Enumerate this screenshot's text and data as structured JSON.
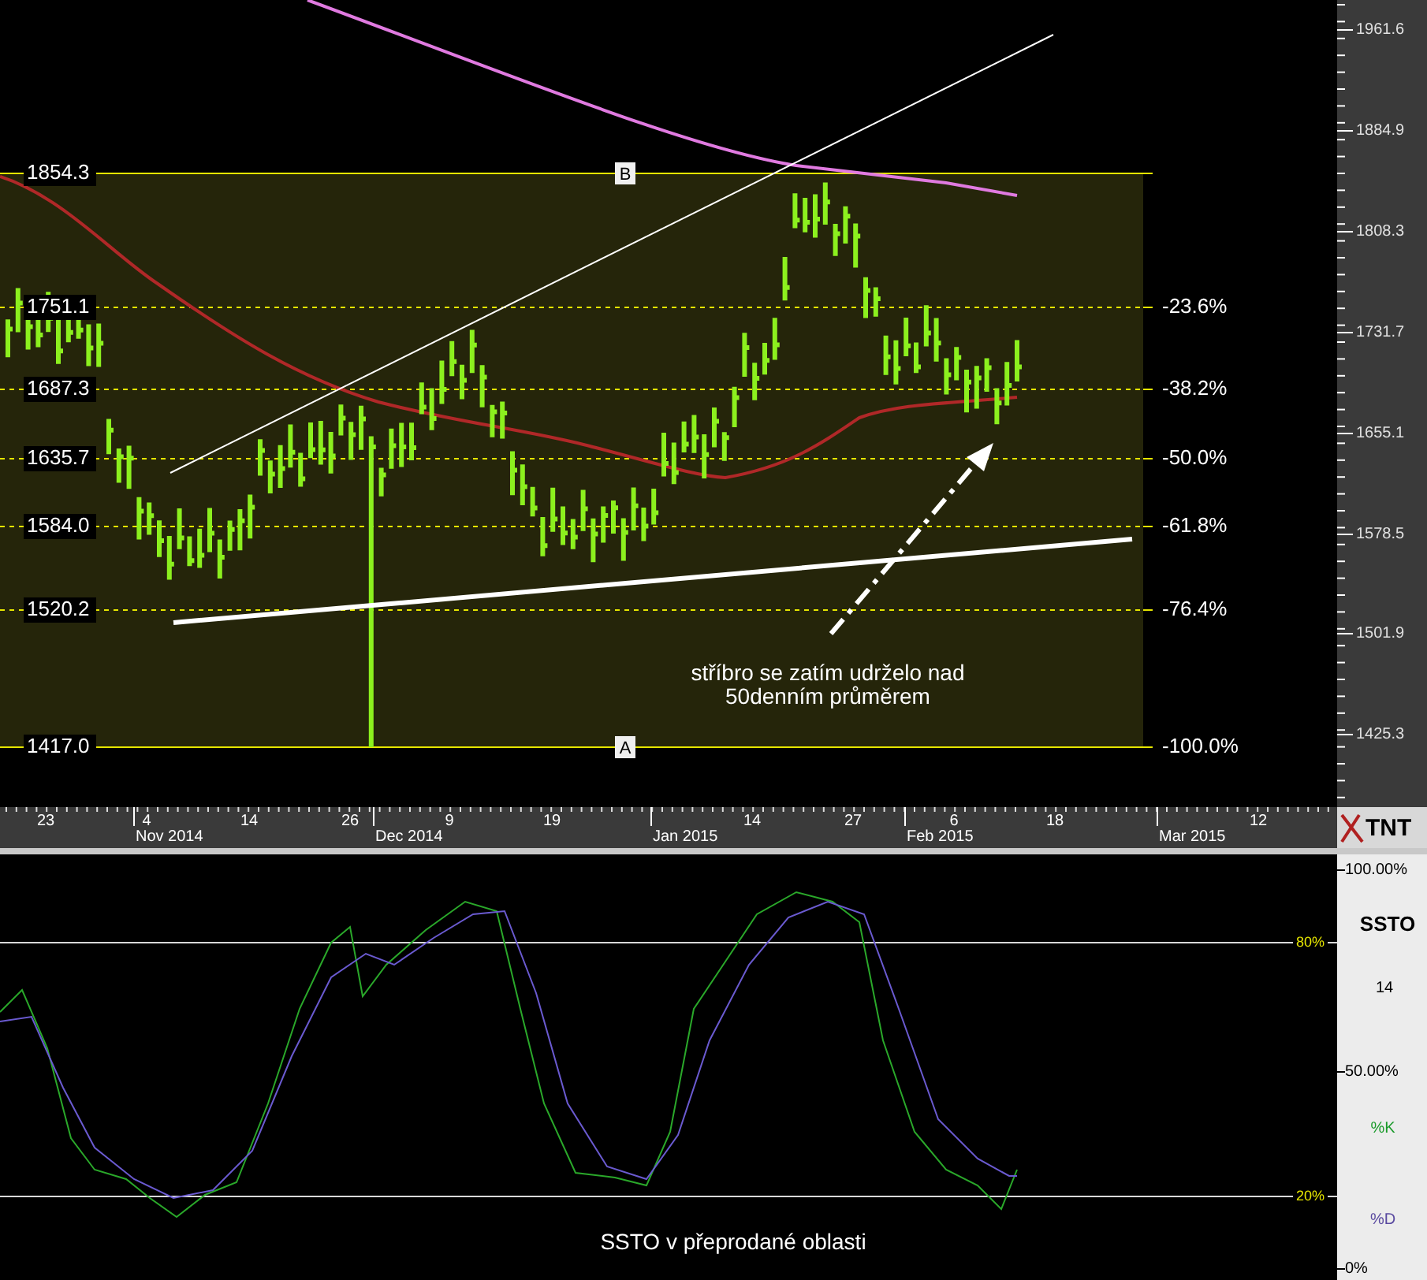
{
  "price_panel": {
    "price_axis": [
      "1961.6",
      "1884.9",
      "1808.3",
      "1731.7",
      "1655.1",
      "1578.5",
      "1501.9",
      "1425.3"
    ],
    "fib_levels": [
      {
        "price": "1854.3"
      },
      {
        "price": "1751.1",
        "percent": "-23.6%"
      },
      {
        "price": "1687.3",
        "percent": "-38.2%"
      },
      {
        "price": "1635.7",
        "percent": "-50.0%"
      },
      {
        "price": "1584.0",
        "percent": "-61.8%"
      },
      {
        "price": "1520.2",
        "percent": "-76.4%"
      },
      {
        "price": "1417.0",
        "percent": "-100.0%"
      }
    ],
    "fib_points": [
      "B",
      "A"
    ],
    "annotation": [
      "stříbro se zatím udrželo nad",
      "50denním průměrem"
    ]
  },
  "time_axis": {
    "days": [
      "23",
      "4",
      "14",
      "26",
      "9",
      "19",
      "14",
      "27",
      "6",
      "18",
      "12"
    ],
    "months": [
      "Nov 2014",
      "Dec 2014",
      "Jan 2015",
      "Feb 2015",
      "Mar 2015"
    ],
    "logo": "TNT"
  },
  "oscillator": {
    "title": "SSTO",
    "period": "14",
    "scale": [
      "100.00%",
      "50.00%",
      "0%"
    ],
    "levels": [
      "80%",
      "20%"
    ],
    "k_label": "%K",
    "d_label": "%D",
    "caption": "SSTO v přeprodané oblasti"
  }
}
